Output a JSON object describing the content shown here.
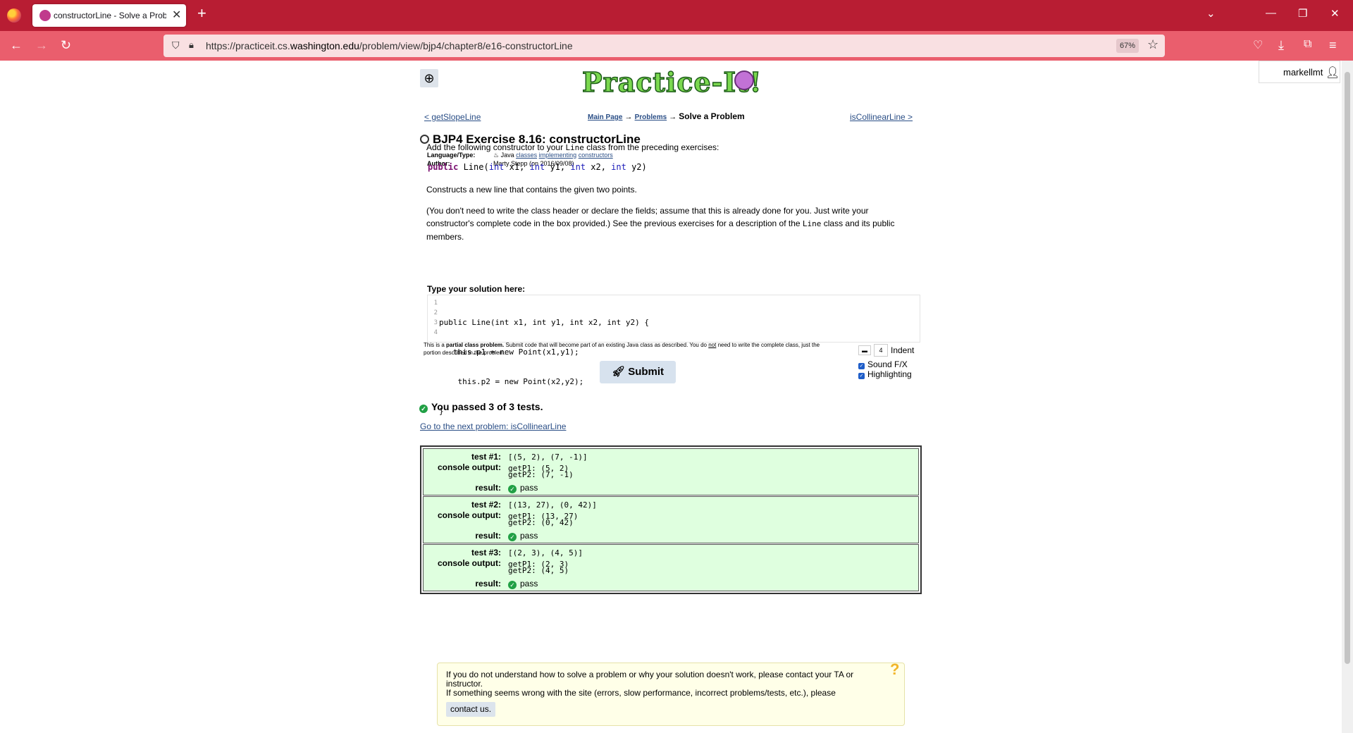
{
  "browser": {
    "tab_title": "constructorLine - Solve a Probl",
    "url_prefix": "https://practiceit.cs.",
    "url_domain": "washington.edu",
    "url_path": "/problem/view/bjp4/chapter8/e16-constructorLine",
    "zoom": "67%"
  },
  "header": {
    "logo_text": "Practice-It!",
    "username": "markellmt"
  },
  "nav": {
    "prev_link": "< getSlopeLine",
    "next_link": "isCollinearLine >",
    "crumb_main": "Main Page",
    "crumb_problems": "Problems",
    "crumb_current": "Solve a Problem",
    "arrow": "→"
  },
  "problem": {
    "title": "BJP4 Exercise 8.16: constructorLine",
    "lang_label": "Language/Type:",
    "lang_value": "Java",
    "tags": [
      "classes",
      "implementing",
      "constructors"
    ],
    "author_label": "Author:",
    "author_value": "Marty Stepp (on 2016/09/08)",
    "intro_a": "Add the following constructor to your ",
    "intro_code": "Line",
    "intro_b": " class from the preceding exercises:",
    "signature": {
      "kw": "public",
      "name": " Line(",
      "t1": "int",
      "p1": " x1, ",
      "t2": "int",
      "p2": " y1, ",
      "t3": "int",
      "p3": " x2, ",
      "t4": "int",
      "p4": " y2)"
    },
    "desc1": "Constructs a new line that contains the given two points.",
    "desc2_a": "(You don't need to write the class header or declare the fields; assume that this is already done for you. Just write your constructor's complete code in the box provided.) See the previous exercises for a description of the ",
    "desc2_code": "Line",
    "desc2_b": " class and its public members."
  },
  "editor": {
    "label": "Type your solution here:",
    "line_numbers": [
      "1",
      "2",
      "3",
      "4"
    ],
    "lines": [
      "public Line(int x1, int y1, int x2, int y2) {",
      "   this.p1 = new Point(x1,y1);",
      "    this.p2 = new Point(x2,y2);",
      "}"
    ]
  },
  "partial_note": {
    "a": "This is a ",
    "bold": "partial class problem.",
    "b": " Submit code that will become part of an existing Java class as described. You do ",
    "not": "not",
    "c": " need to write the complete class, just the portion described in the problem."
  },
  "options": {
    "indent_value": "4",
    "indent_label": "Indent",
    "sound_label": "Sound F/X",
    "highlight_label": "Highlighting"
  },
  "submit_label": "Submit",
  "results": {
    "summary": "You passed 3 of 3 tests.",
    "next_problem": "Go to the next problem: isCollinearLine",
    "tests": [
      {
        "label": "test #1:",
        "input": "[(5, 2), (7, -1)]",
        "out1": "getP1: (5, 2)",
        "out2": "getP2: (7, -1)",
        "result": "pass"
      },
      {
        "label": "test #2:",
        "input": "[(13, 27), (0, 42)]",
        "out1": "getP1: (13, 27)",
        "out2": "getP2: (0, 42)",
        "result": "pass"
      },
      {
        "label": "test #3:",
        "input": "[(2, 3), (4, 5)]",
        "out1": "getP1: (2, 3)",
        "out2": "getP2: (4, 5)",
        "result": "pass"
      }
    ],
    "console_label": "console output:",
    "result_label": "result:"
  },
  "help": {
    "line1": "If you do not understand how to solve a problem or why your solution doesn't work, please contact your TA or instructor.",
    "line2": "If something seems wrong with the site (errors, slow performance, incorrect problems/tests, etc.), please",
    "contact": "contact us."
  },
  "colors": {
    "chrome": "#b81d33",
    "navbar": "#ea5e6d",
    "pass_bg": "#dfffdf",
    "link": "#2a4e86"
  }
}
